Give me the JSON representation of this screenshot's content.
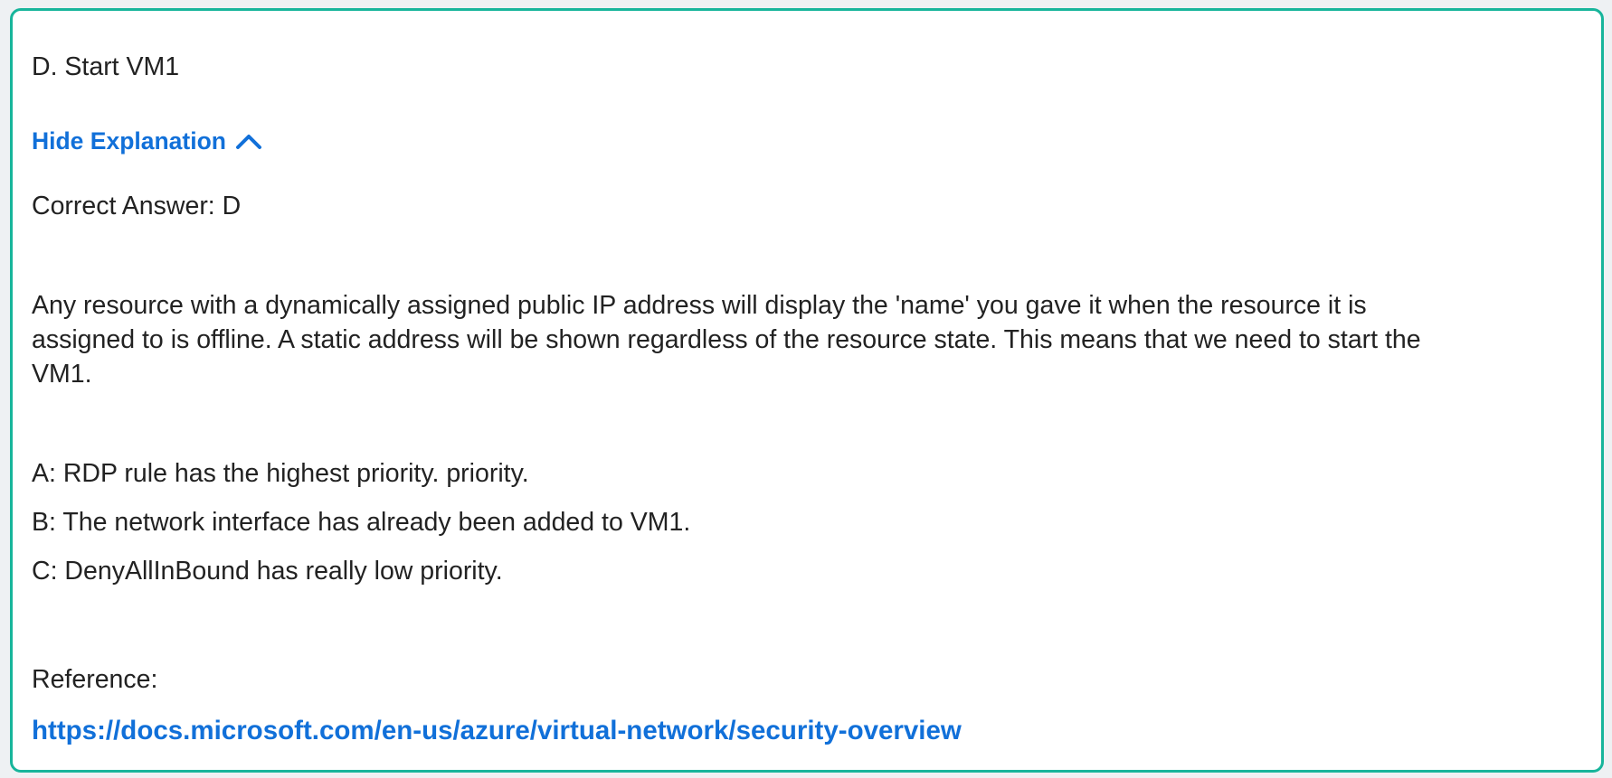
{
  "option_d": "D. Start VM1",
  "toggle": {
    "label": "Hide Explanation",
    "icon": "chevron-up-icon",
    "color": "#1170d9"
  },
  "correct_answer": "Correct Answer: D",
  "explanation_lines": [
    "Any resource with a dynamically assigned public IP address will display the 'name' you gave it when the resource it is",
    "assigned to is offline. A static address will be shown regardless of the resource state. This means that we need to start the",
    "VM1."
  ],
  "notes": [
    "A: RDP rule has the highest priority. priority.",
    "B: The network interface has already been added to VM1.",
    "C: DenyAllInBound has really low priority."
  ],
  "reference_label": "Reference:",
  "reference_url": "https://docs.microsoft.com/en-us/azure/virtual-network/security-overview",
  "colors": {
    "border": "#17b59b",
    "link": "#1170d9",
    "text": "#222222"
  }
}
